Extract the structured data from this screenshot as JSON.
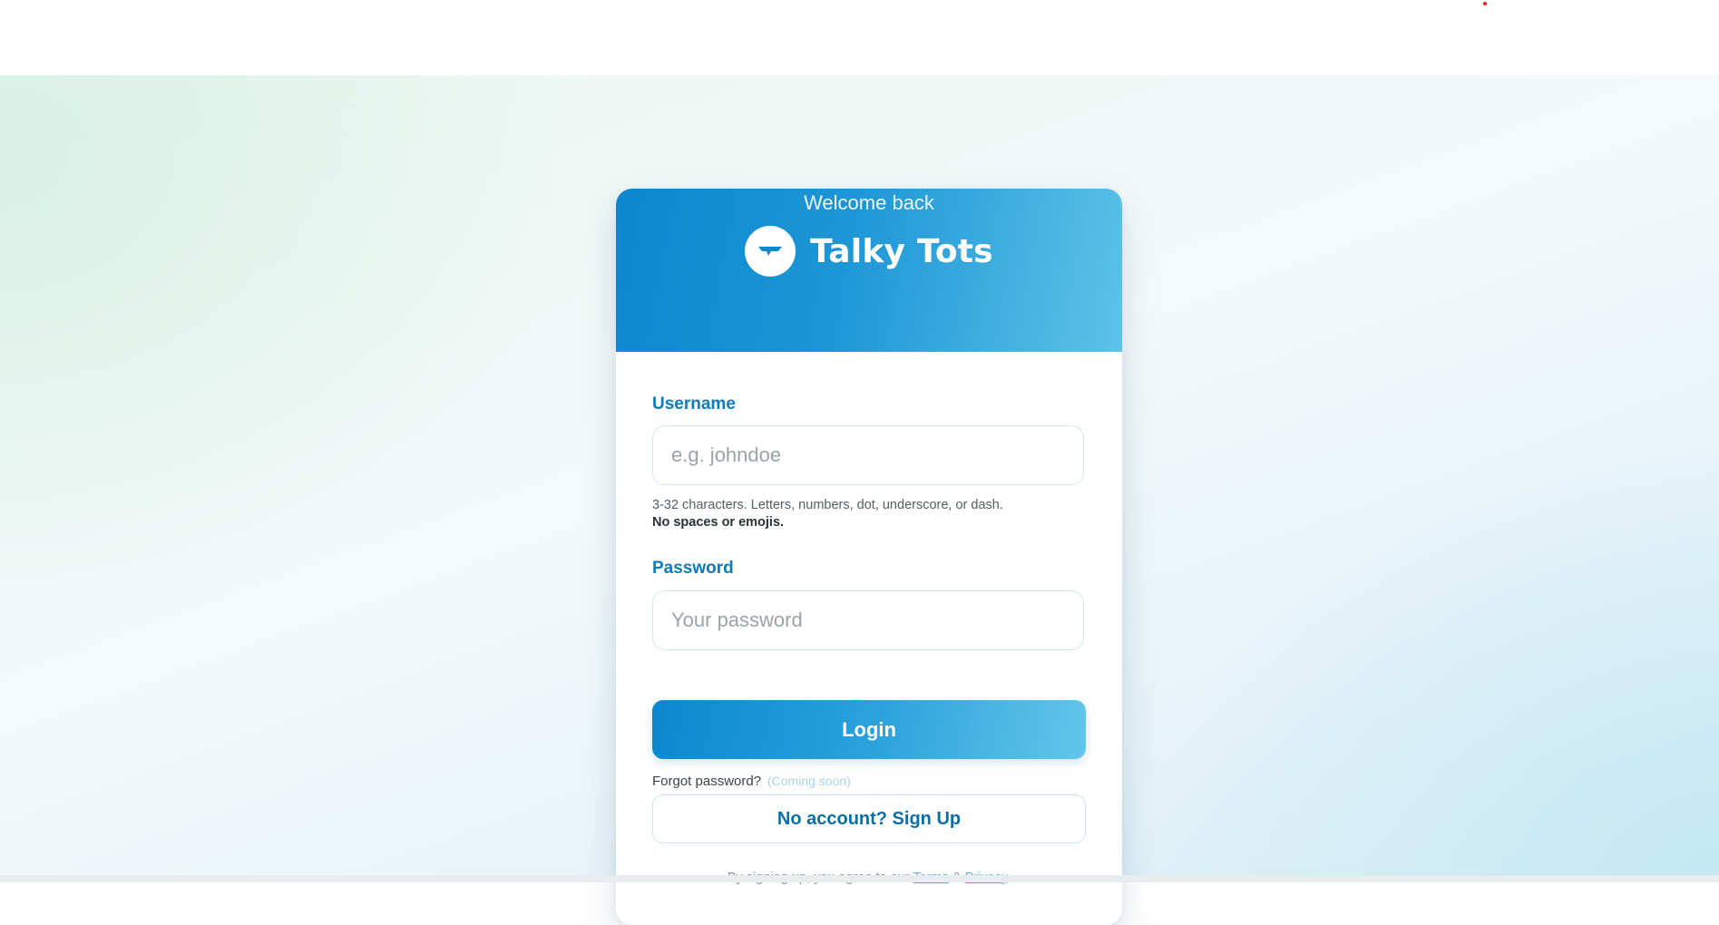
{
  "brand": {
    "name": "Talky Tots",
    "subtitle": "Welcome back"
  },
  "form": {
    "username": {
      "label": "Username",
      "placeholder": "e.g. johndoe",
      "value": "",
      "hint": "3-32 characters. Letters, numbers, dot, underscore, or dash.",
      "hint_strong": "No spaces or emojis."
    },
    "password": {
      "label": "Password",
      "placeholder": "Your password",
      "value": ""
    },
    "forgot_label": "Forgot password?",
    "forgot_note": "(Coming soon)",
    "login_label": "Login",
    "signup_label": "No account? Sign Up"
  },
  "footer": {
    "prefix": "By signing up, you agree to our",
    "terms_link": "Terms",
    "amp": "&",
    "privacy_link": "Privacy",
    "suffix": "."
  },
  "colors": {
    "accent": "#0a87cf",
    "accent_light": "#5cc3e8",
    "label": "#0b7cb8"
  },
  "icons": {
    "logo": "chat-bubble-icon"
  }
}
